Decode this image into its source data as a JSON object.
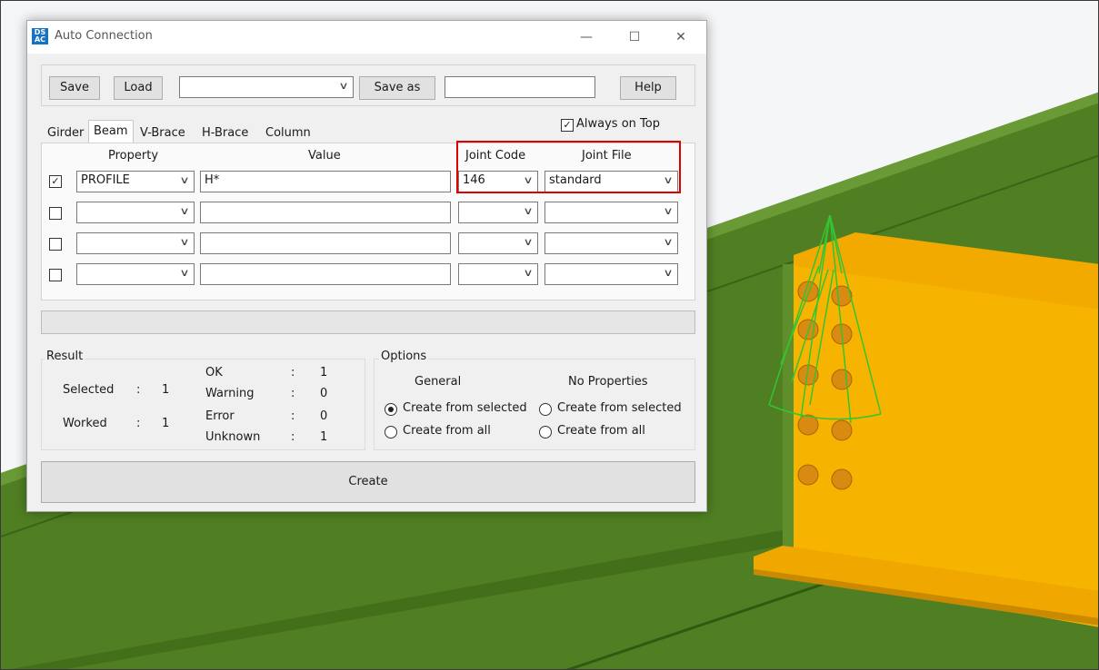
{
  "window": {
    "title": "Auto Connection",
    "icon_text": "DS AC"
  },
  "toolbar": {
    "save_label": "Save",
    "load_label": "Load",
    "preset_value": "",
    "save_as_label": "Save as",
    "save_as_value": "",
    "help_label": "Help"
  },
  "always_on_top": {
    "label": "Always on Top",
    "checked": true
  },
  "tabs": [
    {
      "label": "Girder",
      "active": false
    },
    {
      "label": "Beam",
      "active": true
    },
    {
      "label": "V-Brace",
      "active": false
    },
    {
      "label": "H-Brace",
      "active": false
    },
    {
      "label": "Column",
      "active": false
    }
  ],
  "grid": {
    "headers": {
      "property": "Property",
      "value": "Value",
      "joint_code": "Joint Code",
      "joint_file": "Joint File"
    },
    "rows": [
      {
        "checked": true,
        "property": "PROFILE",
        "value": "H*",
        "joint_code": "146",
        "joint_file": "standard"
      },
      {
        "checked": false,
        "property": "",
        "value": "",
        "joint_code": "",
        "joint_file": ""
      },
      {
        "checked": false,
        "property": "",
        "value": "",
        "joint_code": "",
        "joint_file": ""
      },
      {
        "checked": false,
        "property": "",
        "value": "",
        "joint_code": "",
        "joint_file": ""
      }
    ],
    "highlight_color": "#e00000"
  },
  "result": {
    "title": "Result",
    "selected_label": "Selected",
    "selected_value": "1",
    "worked_label": "Worked",
    "worked_value": "1",
    "ok_label": "OK",
    "ok_value": "1",
    "warning_label": "Warning",
    "warning_value": "0",
    "error_label": "Error",
    "error_value": "0",
    "unknown_label": "Unknown",
    "unknown_value": "1",
    "sep": ":"
  },
  "options": {
    "title": "Options",
    "general_header": "General",
    "noprop_header": "No Properties",
    "general_from_selected": "Create from selected",
    "general_from_all": "Create from all",
    "noprop_from_selected": "Create from selected",
    "noprop_from_all": "Create from all",
    "general_selected": "from_selected",
    "noprop_selected": "none"
  },
  "create_label": "Create",
  "colors": {
    "ground": "#4a7a1e",
    "steel": "#f5b300",
    "bolt": "#d0890a",
    "symbol": "#2bc82b"
  }
}
